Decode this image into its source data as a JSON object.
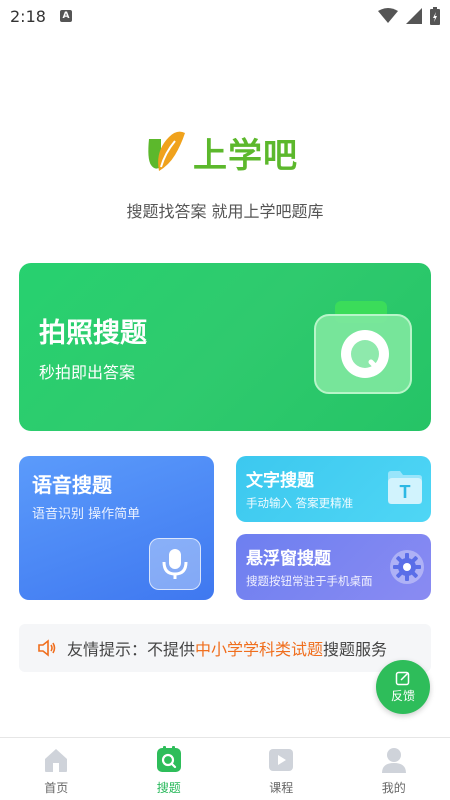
{
  "status_bar": {
    "time": "2:18",
    "notification_badge": "A"
  },
  "header": {
    "logo_text": "上学吧",
    "tagline": "搜题找答案 就用上学吧题库"
  },
  "cards": {
    "photo": {
      "title": "拍照搜题",
      "subtitle": "秒拍即出答案"
    },
    "voice": {
      "title": "语音搜题",
      "subtitle": "语音识别 操作简单"
    },
    "text": {
      "title": "文字搜题",
      "subtitle": "手动输入 答案更精准",
      "icon_letter": "T"
    },
    "float": {
      "title": "悬浮窗搜题",
      "subtitle": "搜题按钮常驻于手机桌面"
    }
  },
  "tip": {
    "prefix": "友情提示：不提供",
    "highlight": "中小学学科类试题",
    "suffix": "搜题服务"
  },
  "feedback": {
    "label": "反馈"
  },
  "bottom_nav": {
    "items": [
      {
        "label": "首页",
        "icon": "home-icon"
      },
      {
        "label": "搜题",
        "icon": "search-icon",
        "active": true
      },
      {
        "label": "课程",
        "icon": "play-icon"
      },
      {
        "label": "我的",
        "icon": "user-icon"
      }
    ]
  },
  "colors": {
    "brand_green": "#2ebd5a",
    "photo_card": "#27d16f",
    "voice_card": "#4b86f5",
    "text_card": "#45d0f2",
    "float_card": "#7b85f1",
    "tip_highlight": "#f06e1d"
  }
}
